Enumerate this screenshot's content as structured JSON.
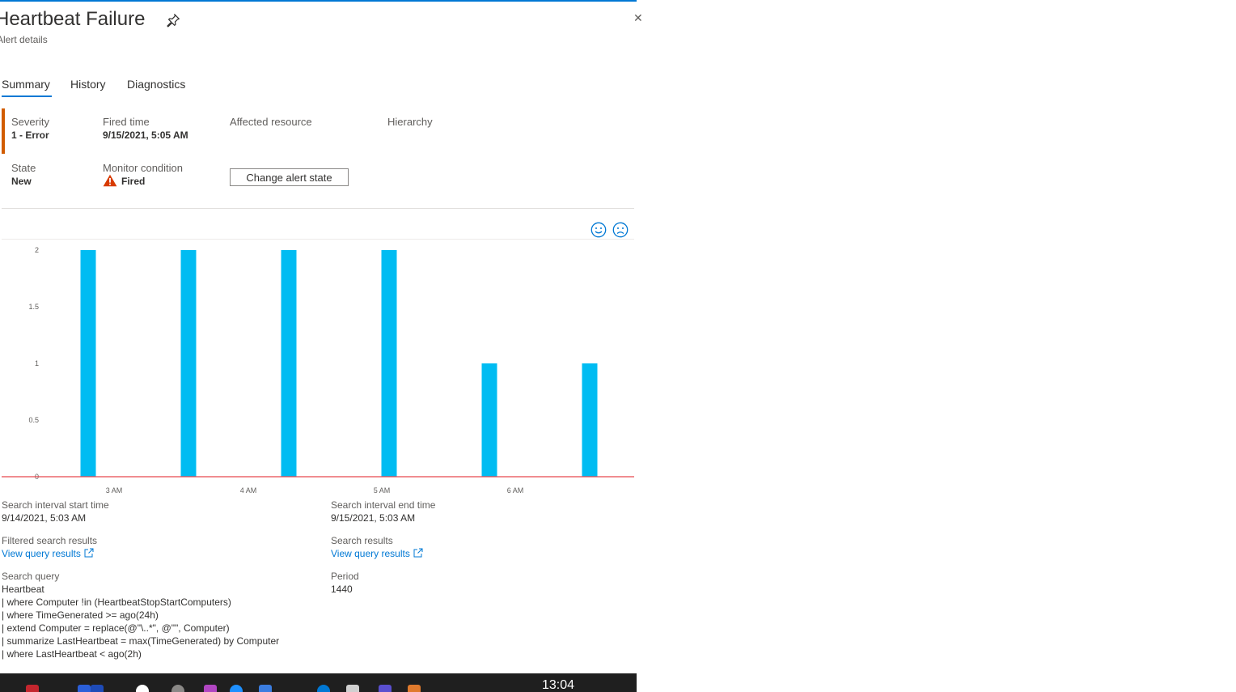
{
  "header": {
    "title": "Heartbeat Failure",
    "subtitle": "Alert details",
    "close_glyph": "✕"
  },
  "tabs": [
    {
      "label": "Summary",
      "active": true
    },
    {
      "label": "History",
      "active": false
    },
    {
      "label": "Diagnostics",
      "active": false
    }
  ],
  "essentials": {
    "severity_label": "Severity",
    "severity_value": "1 - Error",
    "fired_time_label": "Fired time",
    "fired_time_value": "9/15/2021, 5:05 AM",
    "affected_resource_label": "Affected resource",
    "hierarchy_label": "Hierarchy",
    "state_label": "State",
    "state_value": "New",
    "monitor_condition_label": "Monitor condition",
    "monitor_condition_value": "Fired",
    "change_state_button": "Change alert state"
  },
  "feedback": {
    "happy_icon": "smile-icon",
    "sad_icon": "frown-icon"
  },
  "chart_data": {
    "type": "bar",
    "x_tick_labels": [
      "3 AM",
      "4 AM",
      "5 AM",
      "6 AM"
    ],
    "y_tick_labels": [
      "0",
      "0.5",
      "1",
      "1.5",
      "2"
    ],
    "ylim": [
      0,
      2
    ],
    "values": [
      2,
      2,
      2,
      2,
      1,
      1
    ],
    "bar_color": "#00bcf2",
    "threshold_value": 0,
    "threshold_color": "#e8474d"
  },
  "details": {
    "start_label": "Search interval start time",
    "start_value": "9/14/2021, 5:03 AM",
    "end_label": "Search interval end time",
    "end_value": "9/15/2021, 5:03 AM",
    "filtered_label": "Filtered search results",
    "filtered_link": "View query results",
    "search_results_label": "Search results",
    "search_results_link": "View query results",
    "query_label": "Search query",
    "query_text": "Heartbeat\n| where Computer !in (HeartbeatStopStartComputers)\n| where TimeGenerated >= ago(24h)\n| extend Computer = replace(@\"\\..*\", @\"\", Computer)\n| summarize LastHeartbeat = max(TimeGenerated) by Computer\n| where LastHeartbeat < ago(2h)",
    "period_label": "Period",
    "period_value": "1440"
  },
  "taskbar": {
    "clock": "13:04"
  },
  "colors": {
    "accent": "#0078d4",
    "severity": "#d15c00",
    "warning": "#d83b01"
  }
}
